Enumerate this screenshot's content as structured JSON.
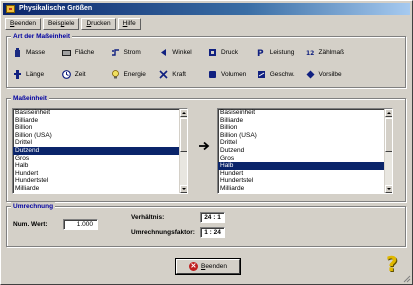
{
  "window": {
    "title": "Physikalische Größen"
  },
  "menubar": [
    {
      "prefix": "",
      "hotkey": "B",
      "rest": "eenden"
    },
    {
      "prefix": "Beis",
      "hotkey": "p",
      "rest": "iele"
    },
    {
      "prefix": "",
      "hotkey": "D",
      "rest": "rucken"
    },
    {
      "prefix": "",
      "hotkey": "H",
      "rest": "ilfe"
    }
  ],
  "quantity_group": {
    "title": "Art der Maßeinheit",
    "items": [
      {
        "label": "Masse",
        "icon": "weight-icon"
      },
      {
        "label": "Fläche",
        "icon": "area-icon"
      },
      {
        "label": "Strom",
        "icon": "current-icon"
      },
      {
        "label": "Winkel",
        "icon": "angle-icon"
      },
      {
        "label": "Druck",
        "icon": "pressure-icon"
      },
      {
        "label": "Leistung",
        "icon": "power-icon"
      },
      {
        "label": "Zählmaß",
        "icon": "count-icon"
      },
      {
        "label": "Länge",
        "icon": "length-icon"
      },
      {
        "label": "Zeit",
        "icon": "clock-icon"
      },
      {
        "label": "Energie",
        "icon": "bulb-icon"
      },
      {
        "label": "Kraft",
        "icon": "force-icon"
      },
      {
        "label": "Volumen",
        "icon": "volume-icon"
      },
      {
        "label": "Geschw.",
        "icon": "speed-icon"
      },
      {
        "label": "Vorsilbe",
        "icon": "prefix-icon"
      }
    ]
  },
  "unit_group": {
    "title": "Maßeinheit",
    "left_list": {
      "items": [
        "Basiseinheit",
        "Billiarde",
        "Billion",
        "Billion (USA)",
        "Drittel",
        "Dutzend",
        "Gros",
        "Halb",
        "Hundert",
        "Hundertstel",
        "Milliarde"
      ],
      "selected": "Dutzend"
    },
    "right_list": {
      "items": [
        "Basiseinheit",
        "Billiarde",
        "Billion",
        "Billion (USA)",
        "Drittel",
        "Dutzend",
        "Gros",
        "Halb",
        "Hundert",
        "Hundertstel",
        "Milliarde"
      ],
      "selected": "Halb"
    }
  },
  "conversion_group": {
    "title": "Umrechnung",
    "num_label": "Num. Wert:",
    "num_value": "1.000",
    "ratio_label": "Verhältnis:",
    "ratio_value": "24 : 1",
    "factor_label": "Umrechnungsfaktor:",
    "factor_value": "1 : 24"
  },
  "footer": {
    "close_prefix": "",
    "close_hotkey": "B",
    "close_rest": "eenden",
    "help_glyph": "?"
  },
  "colors": {
    "selection": "#0a246a",
    "group_title": "#0000a0",
    "face": "#d4d0c8"
  }
}
